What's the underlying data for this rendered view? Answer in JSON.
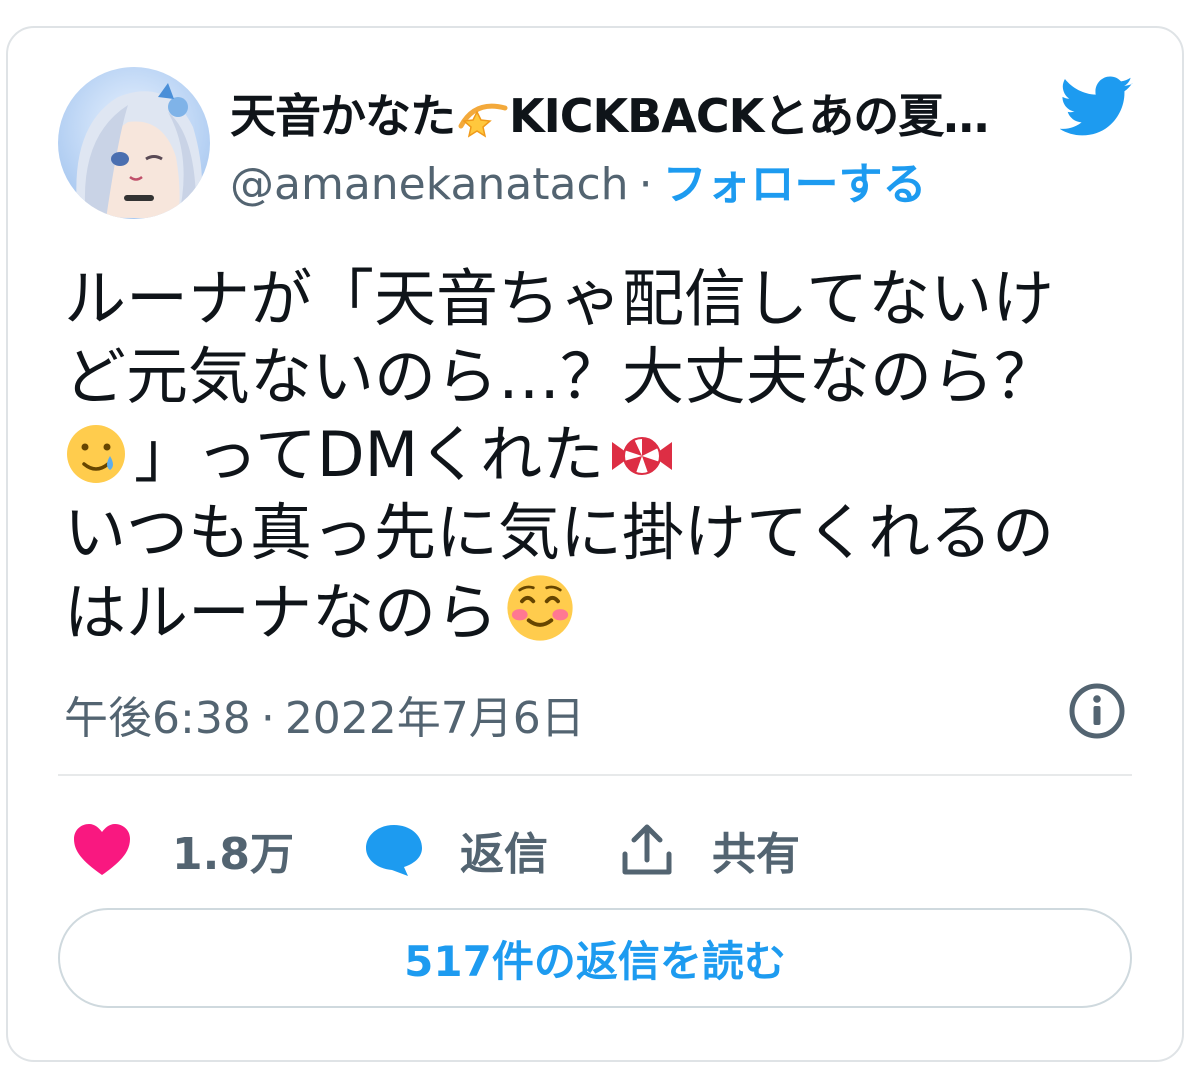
{
  "user": {
    "display_name": "天音かなた",
    "display_name_suffix": "KICKBACKとあの夏…",
    "handle": "@amanekanatach",
    "separator": "·",
    "follow_label": "フォローする"
  },
  "tweet": {
    "lines": [
      "ルーナが「天音ちゃ配信してないけ",
      "ど元気ないのら…？大丈夫なのら？",
      "」ってDMくれた",
      "いつも真っ先に気に掛けてくれるの",
      "はルーナなのら"
    ]
  },
  "meta": {
    "time": "午後6:38",
    "separator": "·",
    "date": "2022年7月6日"
  },
  "actions": {
    "likes": "1.8万",
    "reply_label": "返信",
    "share_label": "共有"
  },
  "read_replies_label": "517件の返信を読む",
  "icons": {
    "brand": "twitter-bird-icon",
    "info": "info-icon",
    "like": "heart-icon",
    "reply": "speech-bubble-icon",
    "share": "share-upload-icon",
    "name_emoji": "dizzy-star-emoji",
    "emoji_1": "crying-face-emoji",
    "emoji_2": "candy-emoji",
    "emoji_3": "smiling-blush-emoji"
  },
  "colors": {
    "accent": "#1d9bf0",
    "like": "#f91880",
    "text": "#0f1419",
    "secondary": "#536471",
    "border": "#dfe3e6"
  }
}
